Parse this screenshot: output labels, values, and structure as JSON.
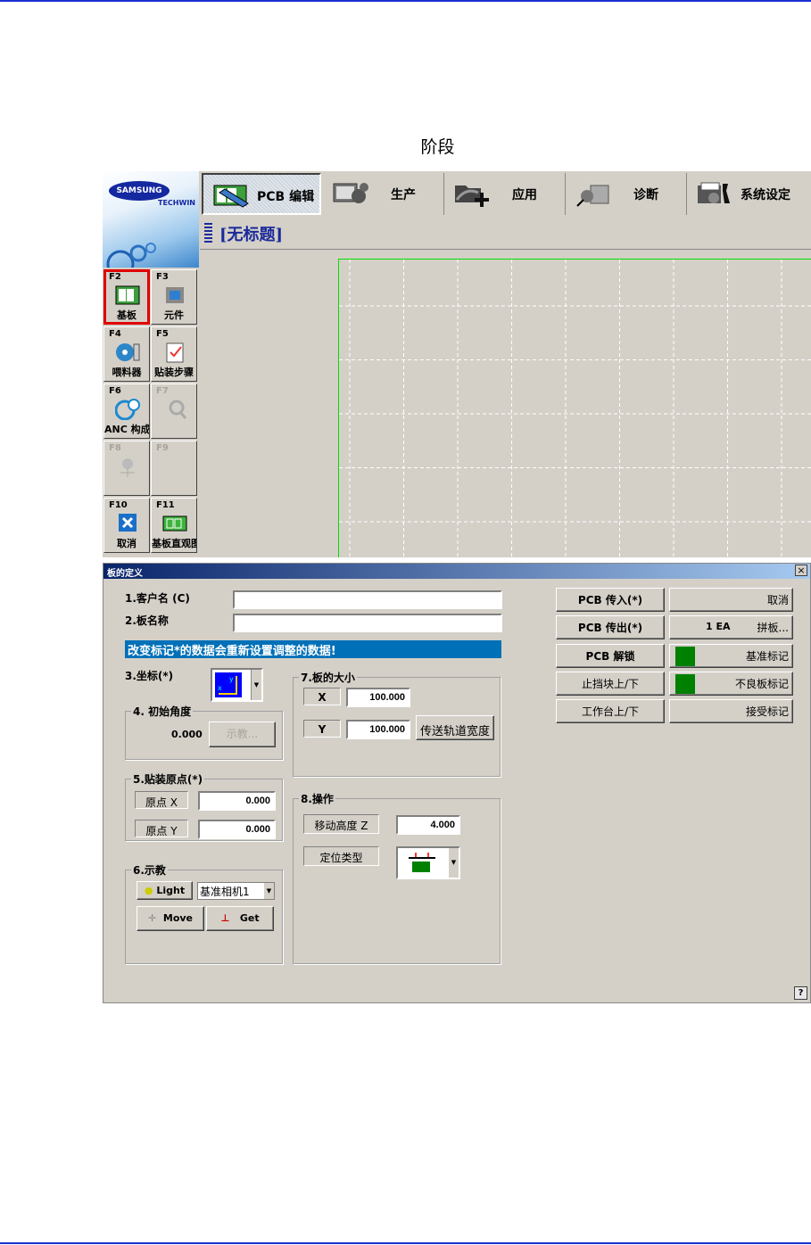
{
  "page": {
    "stage_title": "阶段",
    "accent": "#1a2fd0"
  },
  "app": {
    "logo": {
      "brand": "SAMSUNG",
      "sub": "TECHWIN"
    },
    "tabs": [
      {
        "label": "PCB 编辑",
        "icon": "pcb-edit-icon",
        "active": true
      },
      {
        "label": "生产",
        "icon": "production-gears-icon"
      },
      {
        "label": "应用",
        "icon": "application-folder-icon"
      },
      {
        "label": "诊断",
        "icon": "diagnosis-icon"
      },
      {
        "label": "系统设定",
        "icon": "system-settings-icon"
      }
    ],
    "doc_title": "[无标题]",
    "fkeys": [
      {
        "key": "F2",
        "label": "基板",
        "selected": true,
        "icon": "board-icon"
      },
      {
        "key": "F3",
        "label": "元件",
        "icon": "component-chip-icon"
      },
      {
        "key": "F4",
        "label": "喂料器",
        "icon": "feeder-reel-icon"
      },
      {
        "key": "F5",
        "label": "贴装步骤",
        "icon": "placement-steps-icon"
      },
      {
        "key": "F6",
        "label": "ANC 构成",
        "icon": "anc-icon"
      },
      {
        "key": "F7",
        "label": "",
        "disabled": true,
        "icon": "search-icon"
      },
      {
        "key": "F8",
        "label": "",
        "disabled": true,
        "icon": "nozzle-icon"
      },
      {
        "key": "F9",
        "label": "",
        "disabled": true
      },
      {
        "key": "F10",
        "label": "取消",
        "icon": "cancel-x-icon"
      },
      {
        "key": "F11",
        "label": "基板直观图",
        "icon": "board-view-icon"
      }
    ]
  },
  "dialog": {
    "title": "板的定义",
    "customer_label": "1.客户名 (C)",
    "customer_value": "",
    "board_name_label": "2.板名称",
    "board_name_value": "",
    "warning": "改变标记*的数据会重新设置调整的数据!",
    "coord_label": "3.坐标(*)",
    "angle_group": "4. 初始角度",
    "angle_value": "0.000",
    "teach_btn": "示教...",
    "origin_group": "5.贴装原点(*)",
    "origin_x_label": "原点 X",
    "origin_x": "0.000",
    "origin_y_label": "原点 Y",
    "origin_y": "0.000",
    "teach_group": "6.示教",
    "light_btn": "Light",
    "camera_select": "基准相机1",
    "move_btn": "Move",
    "get_btn": "Get",
    "size_group": "7.板的大小",
    "size_x_label": "X",
    "size_x": "100.000",
    "size_y_label": "Y",
    "size_y": "100.000",
    "conveyor_btn": "传送轨道宽度",
    "op_group": "8.操作",
    "move_height_label": "移动高度 Z",
    "move_height": "4.000",
    "locate_type_label": "定位类型",
    "right_buttons": {
      "pcb_in": "PCB 传入(*)",
      "pcb_out": "PCB 传出(*)",
      "pcb_unlock": "PCB 解锁",
      "stopper": "止挡块上/下",
      "table": "工作台上/下",
      "cancel": "取消",
      "array_count": "1 EA",
      "array": "拼板...",
      "fiducial": "基准标记",
      "bad_mark": "不良板标记",
      "accept_mark": "接受标记"
    },
    "help": "?",
    "close": "×"
  }
}
